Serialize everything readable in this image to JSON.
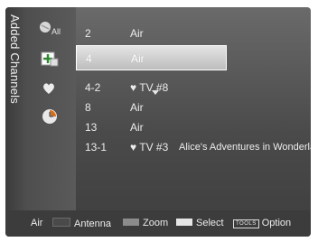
{
  "title": "Added Channels",
  "sidebar": {
    "items": [
      {
        "label": "All",
        "icon": "all-channels-icon"
      },
      {
        "label": "",
        "icon": "added-channels-icon"
      },
      {
        "label": "",
        "icon": "favorites-heart-icon"
      },
      {
        "label": "",
        "icon": "programmed-clock-icon"
      }
    ]
  },
  "channels": [
    {
      "number": "2",
      "name": "Air",
      "program": ""
    },
    {
      "number": "4",
      "name": "Air",
      "program": "",
      "selected": true
    },
    {
      "number": "4-2",
      "name": "♥ TV #8",
      "program": ""
    },
    {
      "number": "8",
      "name": "Air",
      "program": ""
    },
    {
      "number": "13",
      "name": "Air",
      "program": ""
    },
    {
      "number": "13-1",
      "name": "♥ TV #3",
      "program": "Alice's Adventures in Wonderland"
    }
  ],
  "footer": {
    "source": "Air",
    "antenna": "Antenna",
    "zoom": "Zoom",
    "select": "Select",
    "tools_badge": "TOOLS",
    "option": "Option"
  },
  "colors": {
    "red_button": "#b41e1e",
    "green_button": "#2a9a2a",
    "yellow_button": "#d8c41a",
    "blue_button": "#2050c0",
    "selection": "#d6d6d6"
  }
}
